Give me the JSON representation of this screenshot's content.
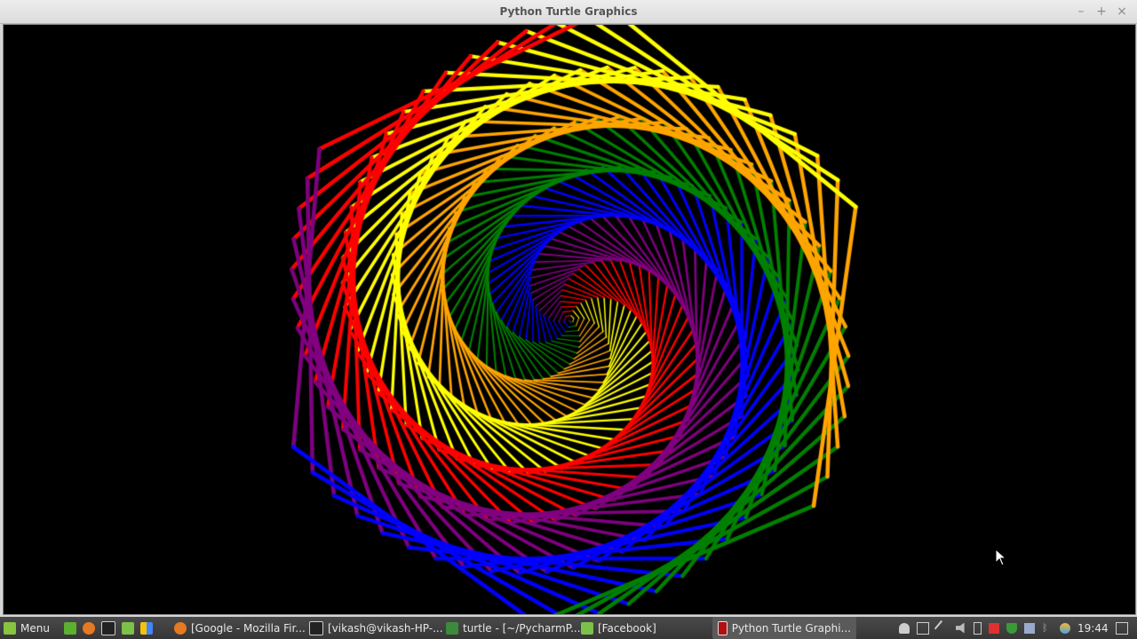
{
  "window": {
    "title": "Python Turtle Graphics"
  },
  "drawing": {
    "colors": [
      "#ff0000",
      "#800080",
      "#0000ff",
      "#008000",
      "#ffa500",
      "#ffff00"
    ],
    "steps": 360,
    "turn_degrees": 59
  },
  "taskbar": {
    "menu_label": "Menu",
    "tasks": [
      {
        "label": "[Google - Mozilla Fir..."
      },
      {
        "label": "[vikash@vikash-HP-..."
      },
      {
        "label": "turtle - [~/PycharmP..."
      },
      {
        "label": "[Facebook]"
      },
      {
        "label": "Python Turtle Graphi..."
      }
    ],
    "clock": "19:44"
  }
}
